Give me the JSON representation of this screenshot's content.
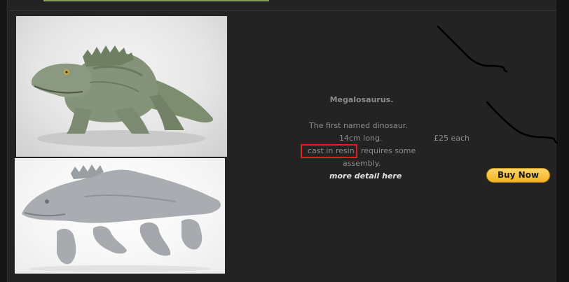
{
  "product": {
    "name": "Megalosaurus.",
    "description_line1": "The first named dinosaur.",
    "description_line2": "14cm long.",
    "description_line3_highlight": "cast in resin",
    "description_line3_rest": "requires some",
    "description_line4": "assembly.",
    "price": "£25 each",
    "more_detail_link": "more detail here",
    "buy_button_label": "Buy Now"
  },
  "colors": {
    "page_background": "#232323",
    "muted_text": "#8c8c8c",
    "link_text": "#e2e2e2",
    "buy_button": "#f5bd2e",
    "highlight_box": "#e02020"
  },
  "images": {
    "top": "painted-megalosaurus-model-photo",
    "bottom": "unpainted-resin-kit-parts-photo"
  }
}
